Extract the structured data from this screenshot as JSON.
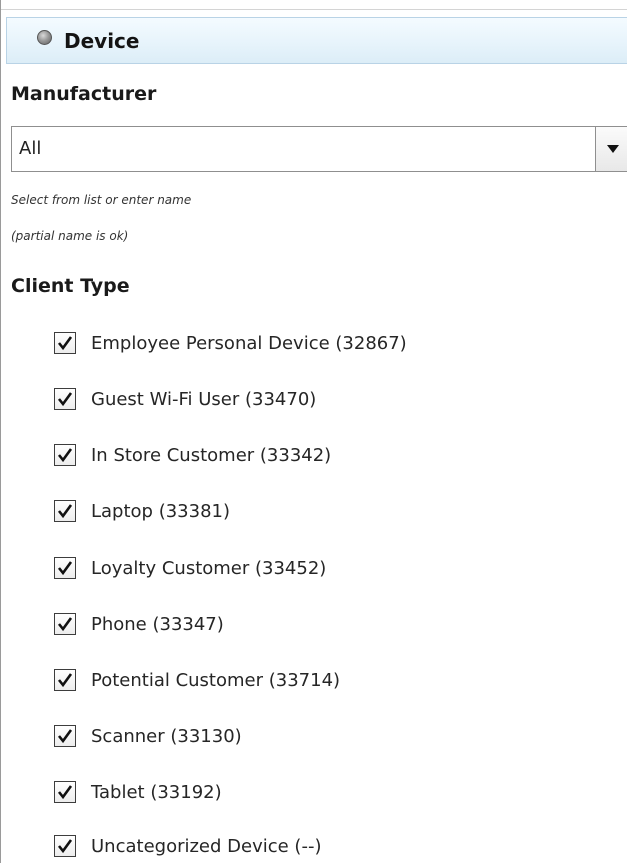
{
  "section": {
    "title": "Device",
    "icon": "bullet-icon"
  },
  "manufacturer": {
    "label": "Manufacturer",
    "selected_value": "All",
    "hint_line_1": "Select from list or enter name",
    "hint_line_2": "(partial name is ok)"
  },
  "client_type": {
    "label": "Client Type",
    "options": [
      {
        "label": "Employee Personal Device (32867)",
        "checked": true
      },
      {
        "label": "Guest Wi-Fi User (33470)",
        "checked": true
      },
      {
        "label": "In Store Customer (33342)",
        "checked": true
      },
      {
        "label": "Laptop (33381)",
        "checked": true
      },
      {
        "label": "Loyalty Customer (33452)",
        "checked": true
      },
      {
        "label": "Phone (33347)",
        "checked": true
      },
      {
        "label": "Potential Customer (33714)",
        "checked": true
      },
      {
        "label": "Scanner (33130)",
        "checked": true
      },
      {
        "label": "Tablet (33192)",
        "checked": true
      },
      {
        "label": "Uncategorized Device (--)",
        "checked": true
      }
    ]
  },
  "colors": {
    "header_background": "#e6f3fb",
    "header_border": "#b9d3e6",
    "text": "#1a1a1a"
  }
}
